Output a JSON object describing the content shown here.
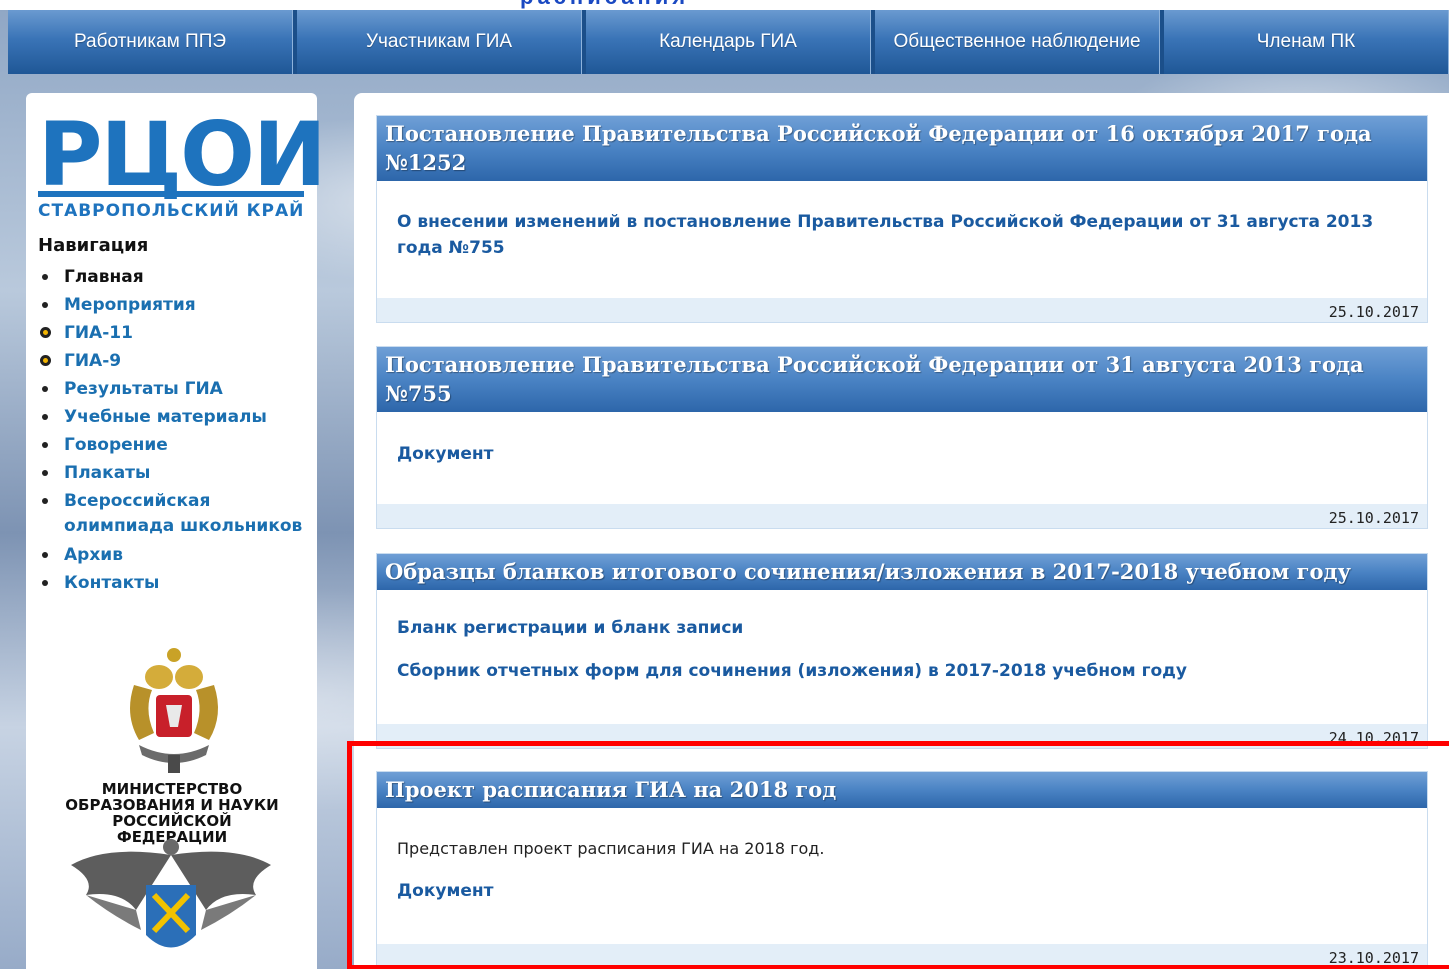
{
  "top_cut_title": "расписания",
  "navbar": {
    "items": [
      "Работникам ППЭ",
      "Участникам ГИА",
      "Календарь ГИА",
      "Общественное наблюдение",
      "Членам ПК"
    ]
  },
  "logo": {
    "main": "РЦОИ",
    "sub": "СТАВРОПОЛЬСКИЙ КРАЙ"
  },
  "sidebar": {
    "nav_title": "Навигация",
    "items": [
      {
        "label": "Главная"
      },
      {
        "label": "Мероприятия"
      },
      {
        "label": "ГИА-11"
      },
      {
        "label": "ГИА-9"
      },
      {
        "label": "Результаты ГИА"
      },
      {
        "label": "Учебные материалы"
      },
      {
        "label": "Говорение"
      },
      {
        "label": "Плакаты"
      },
      {
        "label": "Всероссийская олимпиада школьников"
      },
      {
        "label": "Архив"
      },
      {
        "label": "Контакты"
      }
    ],
    "ministry_text": "МИНИСТЕРСТВО ОБРАЗОВАНИЯ И НАУКИ РОССИЙСКОЙ ФЕДЕРАЦИИ"
  },
  "articles": [
    {
      "title": "Постановление Правительства Российской Федерации от 16 октября 2017 года №1252",
      "links": [
        "О внесении изменений в постановление Правительства Российской Федерации от 31 августа 2013 года №755"
      ],
      "date": "25.10.2017"
    },
    {
      "title": "Постановление Правительства Российской Федерации от 31 августа 2013 года №755",
      "links": [
        "Документ"
      ],
      "date": "25.10.2017"
    },
    {
      "title": "Образцы бланков итогового сочинения/изложения в 2017-2018 учебном году",
      "links": [
        "Бланк регистрации и бланк записи",
        "Сборник отчетных форм для сочинения (изложения) в 2017-2018 учебном году"
      ],
      "date": "24.10.2017"
    },
    {
      "title": "Проект расписания ГИА на 2018 год",
      "text": "Представлен проект расписания ГИА на 2018 год.",
      "links": [
        "Документ"
      ],
      "date": "23.10.2017"
    }
  ],
  "colors": {
    "accent": "#1e73be",
    "highlight": "#ff0000",
    "header_blue": "#2d66aa"
  }
}
